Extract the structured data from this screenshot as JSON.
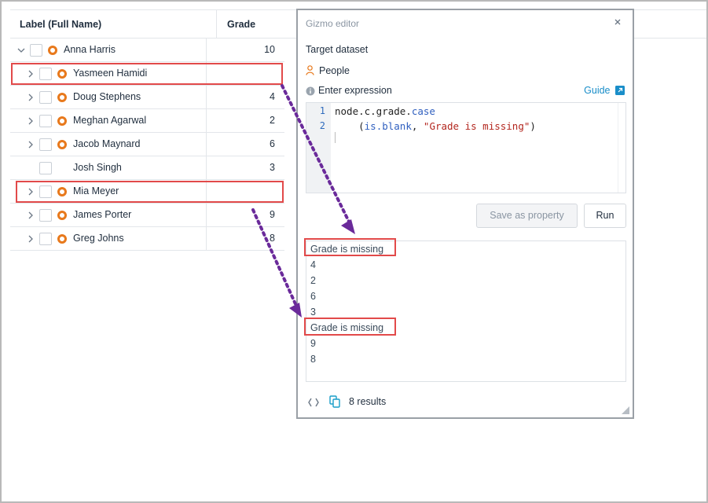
{
  "table": {
    "headers": {
      "label": "Label (Full Name)",
      "grade": "Grade"
    },
    "rows": [
      {
        "name": "Anna Harris",
        "grade": "10",
        "expanded": true,
        "has_children": true
      },
      {
        "name": "Yasmeen Hamidi",
        "grade": "",
        "expanded": false,
        "has_children": true
      },
      {
        "name": "Doug Stephens",
        "grade": "4",
        "expanded": false,
        "has_children": true
      },
      {
        "name": "Meghan Agarwal",
        "grade": "2",
        "expanded": false,
        "has_children": true
      },
      {
        "name": "Jacob Maynard",
        "grade": "6",
        "expanded": false,
        "has_children": true
      },
      {
        "name": "Josh Singh",
        "grade": "3",
        "expanded": false,
        "has_children": false
      },
      {
        "name": "Mia Meyer",
        "grade": "",
        "expanded": false,
        "has_children": true
      },
      {
        "name": "James Porter",
        "grade": "9",
        "expanded": false,
        "has_children": true
      },
      {
        "name": "Greg Johns",
        "grade": "8",
        "expanded": false,
        "has_children": true
      }
    ]
  },
  "editor": {
    "title": "Gizmo editor",
    "target_label": "Target dataset",
    "dataset": "People",
    "expression_label": "Enter expression",
    "guide_link": "Guide",
    "code": {
      "line_numbers": [
        "1",
        "2"
      ],
      "line1": {
        "prefix": "node.c.grade.",
        "keyword": "case"
      },
      "line2": {
        "open": "    (",
        "keyword": "is.blank",
        "sep": ", ",
        "string": "\"Grade is missing\"",
        "close": ")"
      }
    },
    "save_button": "Save as property",
    "run_button": "Run",
    "results": [
      "Grade is missing",
      "4",
      "2",
      "6",
      "3",
      "Grade is missing",
      "9",
      "8"
    ],
    "results_count": "8 results"
  },
  "colors": {
    "highlight": "#e24a4a",
    "arrow": "#6a2a9a",
    "node": "#e8791c",
    "link": "#1a8ec9"
  }
}
